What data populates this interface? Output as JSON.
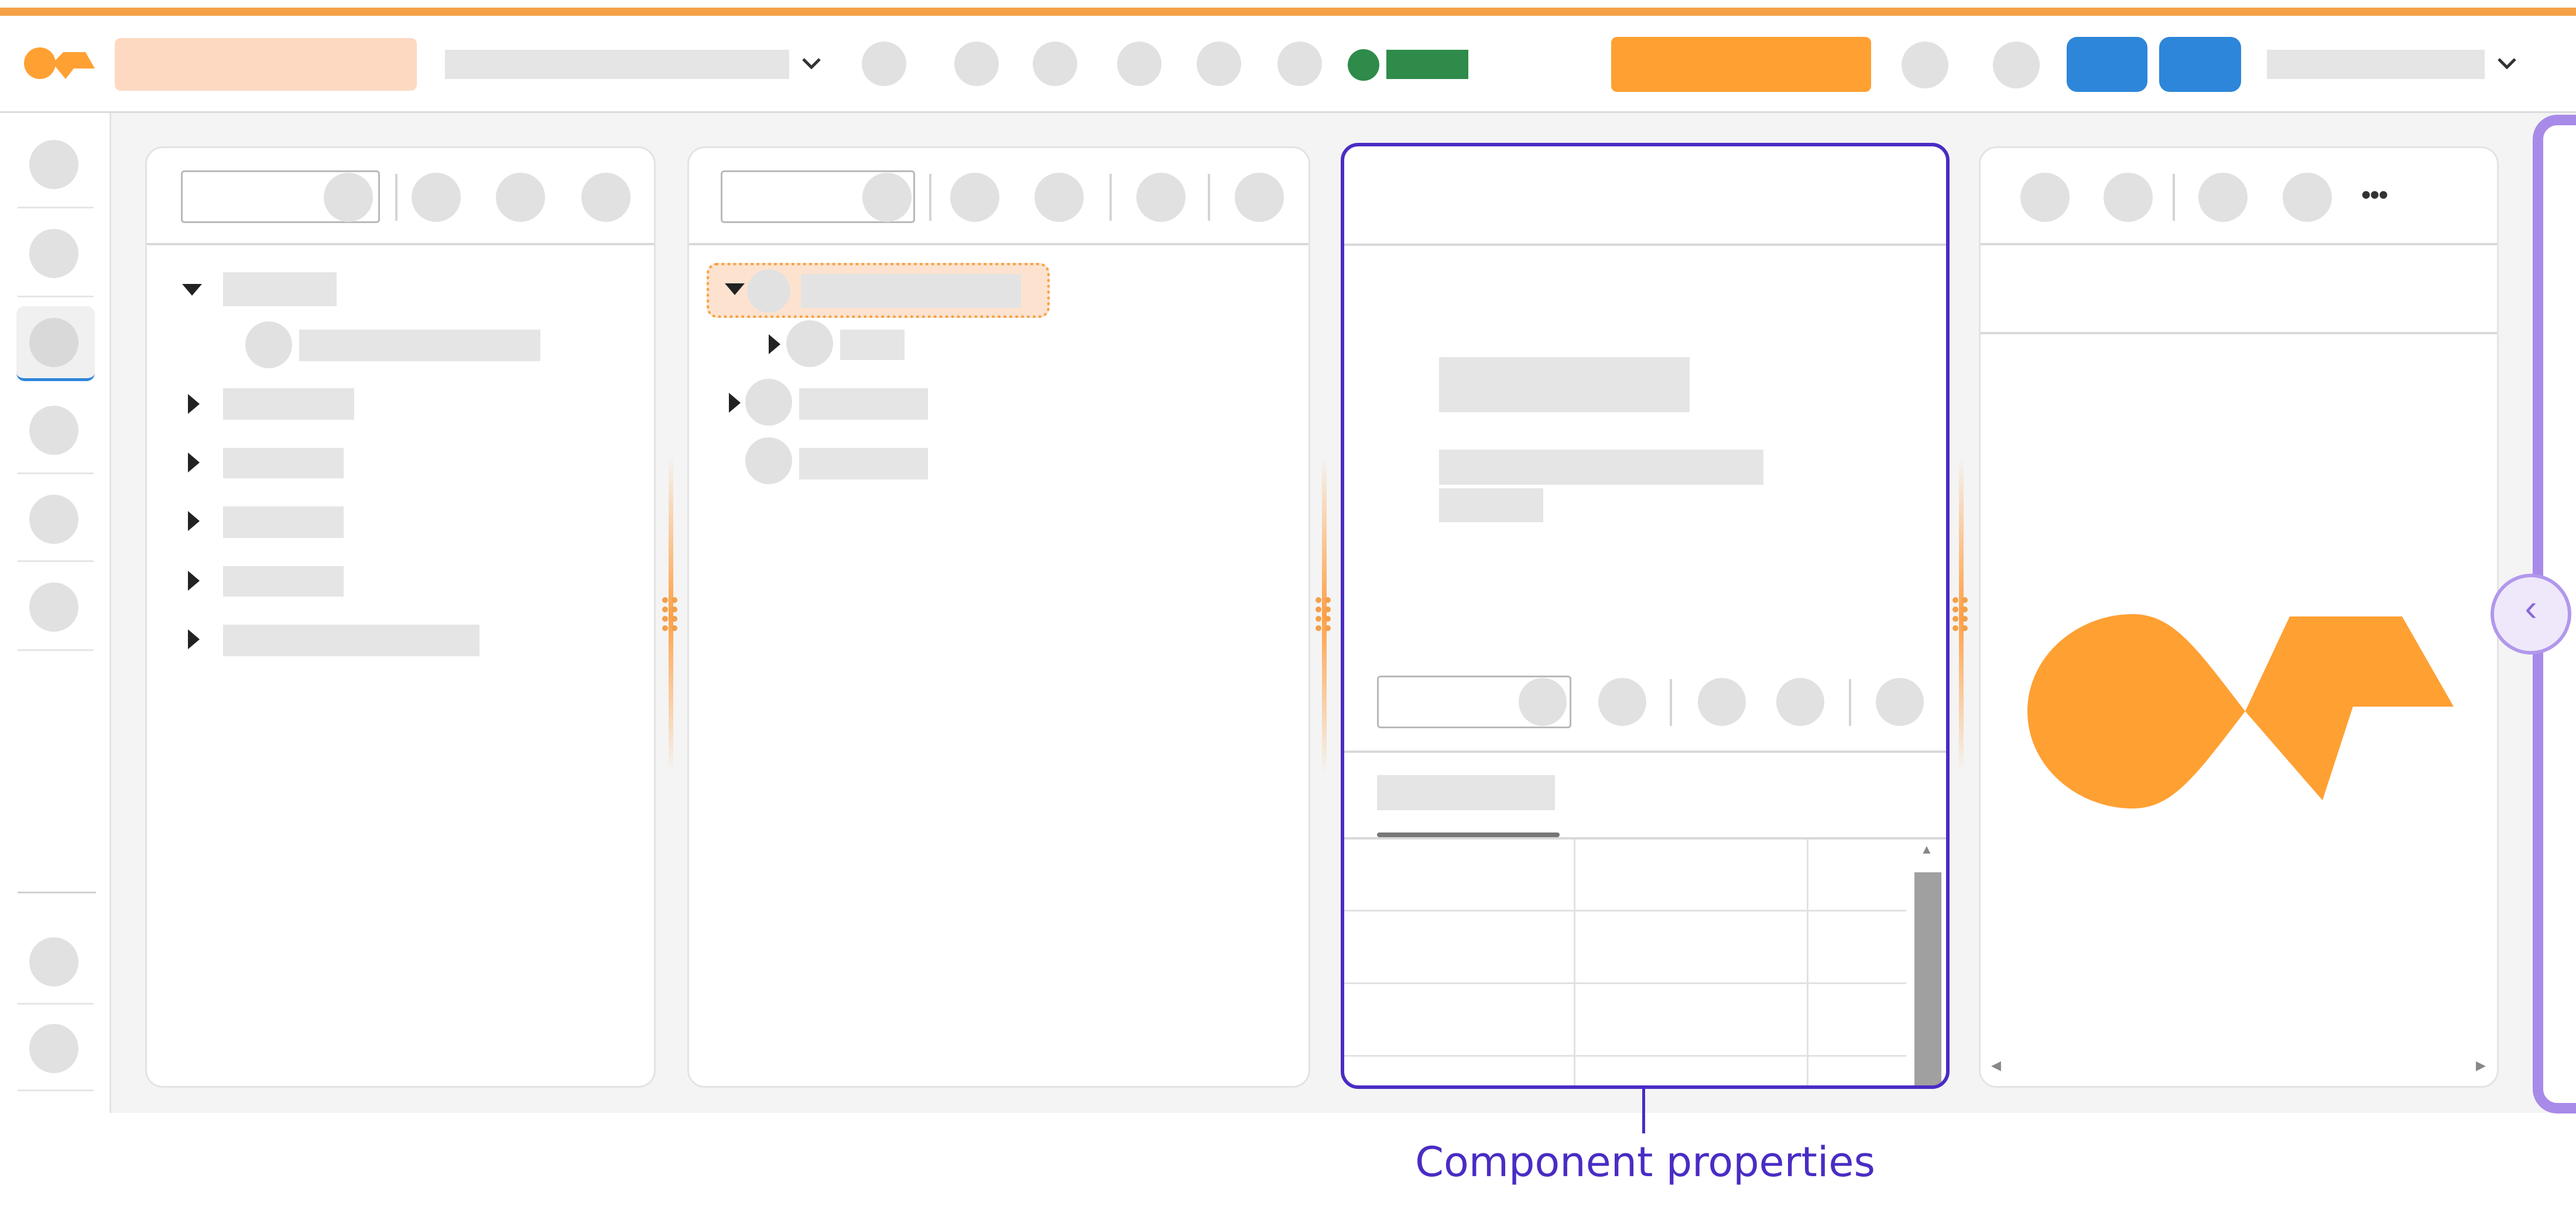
{
  "colors": {
    "accent": "#ffa033",
    "accent_light": "#fdd9c2",
    "status_green": "#2e8b4a",
    "primary_blue": "#2d86d9",
    "highlight_purple": "#4a2cc4",
    "scroll_purple": "#a88ae8",
    "placeholder": "#e5e5e5"
  },
  "icons": {
    "brand": "brand-logo-icon",
    "dropdown": "chevron-down-icon",
    "more": "more-horizontal-icon",
    "collapse": "chevron-left-icon",
    "expand": "caret-right-icon",
    "collapse_tree": "caret-down-icon"
  },
  "toolbar": {
    "more_label": "•••"
  },
  "collapse_toggle": {
    "glyph": "‹"
  },
  "scrollbar": {
    "up_glyph": "▲",
    "left_glyph": "◀",
    "right_glyph": "▶"
  },
  "callout": {
    "label": "Component properties"
  }
}
